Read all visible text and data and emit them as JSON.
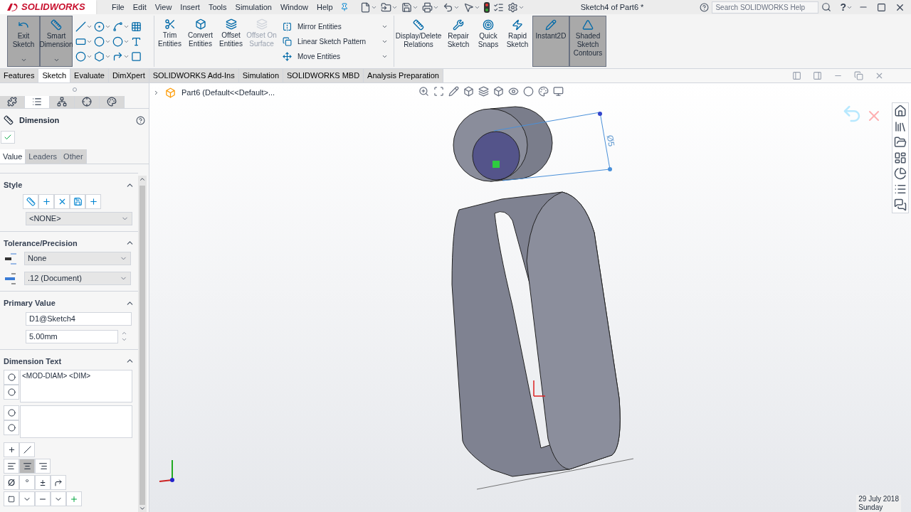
{
  "app_name": "SOLIDWORKS",
  "menu": [
    "File",
    "Edit",
    "View",
    "Insert",
    "Tools",
    "Simulation",
    "Window",
    "Help"
  ],
  "window_title": "Sketch4 of Part6 *",
  "search": {
    "placeholder": "Search SOLIDWORKS Help"
  },
  "help_button": "?",
  "ribbon": {
    "big_buttons": [
      {
        "label": "Exit Sketch",
        "selected": true
      },
      {
        "label": "Smart Dimension",
        "selected": true
      }
    ],
    "tools": [
      {
        "label": "Trim Entities",
        "disabled": false
      },
      {
        "label": "Convert Entities",
        "disabled": false
      },
      {
        "label": "Offset Entities",
        "disabled": false
      },
      {
        "label": "Offset On Surface",
        "disabled": true
      }
    ],
    "list_tools": [
      "Mirror Entities",
      "Linear Sketch Pattern",
      "Move Entities"
    ],
    "right_tools": [
      {
        "label": "Display/Delete Relations",
        "selected": false
      },
      {
        "label": "Repair Sketch",
        "selected": false
      },
      {
        "label": "Quick Snaps",
        "selected": false
      },
      {
        "label": "Rapid Sketch",
        "selected": false
      },
      {
        "label": "Instant2D",
        "selected": true
      },
      {
        "label": "Shaded Sketch Contours",
        "selected": true
      }
    ]
  },
  "tabs": [
    {
      "label": "Features",
      "selected": false
    },
    {
      "label": "Sketch",
      "selected": true
    },
    {
      "label": "Evaluate",
      "selected": false
    },
    {
      "label": "DimXpert",
      "selected": false
    },
    {
      "label": "SOLIDWORKS Add-Ins",
      "selected": false
    },
    {
      "label": "Simulation",
      "selected": false
    },
    {
      "label": "SOLIDWORKS MBD",
      "selected": false
    },
    {
      "label": "Analysis Preparation",
      "selected": false
    }
  ],
  "panel_tabs": [
    {
      "selected": false
    },
    {
      "selected": true
    },
    {
      "selected": false
    },
    {
      "selected": false
    },
    {
      "selected": false
    }
  ],
  "property_manager": {
    "title": "Dimension",
    "subtabs": [
      {
        "label": "Value",
        "selected": true
      },
      {
        "label": "Leaders",
        "selected": false
      },
      {
        "label": "Other",
        "selected": false
      }
    ],
    "style": {
      "title": "Style",
      "expanded": true,
      "dropdown": "<NONE>"
    },
    "tolerance": {
      "title": "Tolerance/Precision",
      "expanded": true,
      "tolerance_type": "None",
      "precision": ".12 (Document)"
    },
    "primary_value": {
      "title": "Primary Value",
      "expanded": true,
      "name": "D1@Sketch4",
      "value": "5.00mm"
    },
    "dimension_text": {
      "title": "Dimension Text",
      "expanded": true,
      "above": "<MOD-DIAM> <DIM>"
    },
    "justify": [
      {
        "selected": false
      },
      {
        "selected": true
      },
      {
        "selected": false
      }
    ],
    "symbols": [
      "Ø",
      "°",
      "±"
    ]
  },
  "viewport": {
    "tree_item": "Part6  (Default<<Default>...",
    "dimension": "Ø5"
  },
  "clock": {
    "date": "29 July 2018",
    "day": "Sunday"
  }
}
